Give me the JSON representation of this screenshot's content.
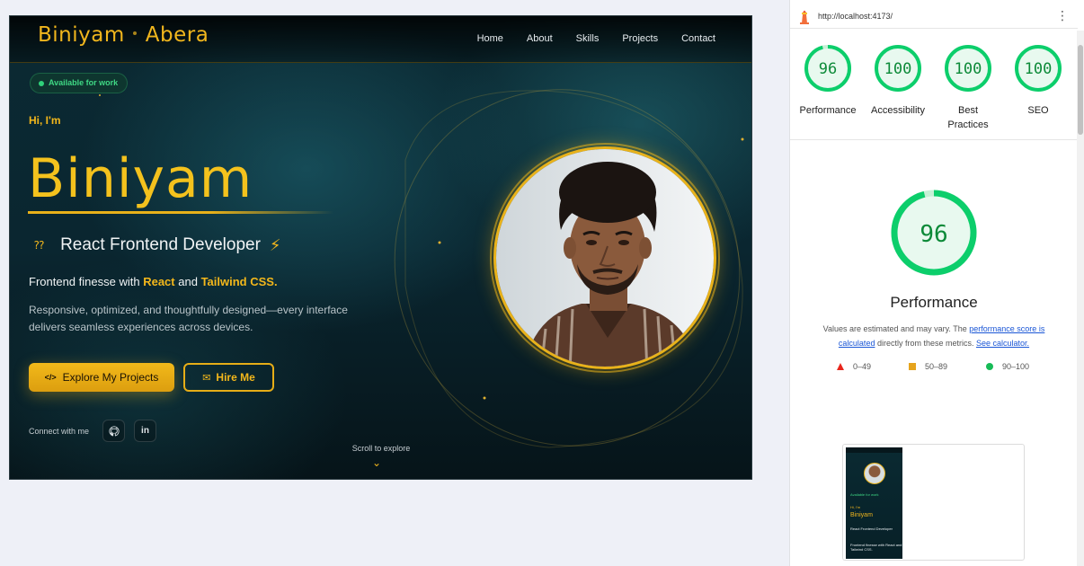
{
  "site": {
    "brand_first": "Biniyam",
    "brand_last": "Abera",
    "nav": [
      "Home",
      "About",
      "Skills",
      "Projects",
      "Contact"
    ],
    "badge": "Available for work",
    "greeting": "Hi, I'm",
    "name": "Biniyam",
    "role": "React Frontend Developer",
    "tagline_prefix": "Frontend finesse with",
    "tagline_react": "React",
    "tagline_and": "and",
    "tagline_tailwind": "Tailwind CSS.",
    "description": "Responsive, optimized, and thoughtfully designed—every interface delivers seamless experiences across devices.",
    "primary_button": "Explore My Projects",
    "secondary_button": "Hire Me",
    "connect_label": "Connect with me",
    "scroll_hint": "Scroll to explore",
    "accent_color": "#f1b61d"
  },
  "lighthouse": {
    "url": "http://localhost:4173/",
    "scores": [
      {
        "label": "Performance",
        "value": "96"
      },
      {
        "label": "Accessibility",
        "value": "100"
      },
      {
        "label": "Best Practices",
        "value": "100"
      },
      {
        "label": "SEO",
        "value": "100"
      }
    ],
    "main_score": "96",
    "main_title": "Performance",
    "note_prefix": "Values are estimated and may vary. The",
    "note_link1": "performance score is calculated",
    "note_middle": "directly from these metrics.",
    "note_link2": "See calculator.",
    "legend": [
      "0–49",
      "50–89",
      "90–100"
    ],
    "pass_color": "#0cce6b",
    "thumbnail": {
      "badge": "Available for work",
      "greeting": "Hi, I'm",
      "name": "Biniyam",
      "role": "React Frontend Developer",
      "tagline": "Frontend finesse with React and Tailwind CSS."
    }
  }
}
